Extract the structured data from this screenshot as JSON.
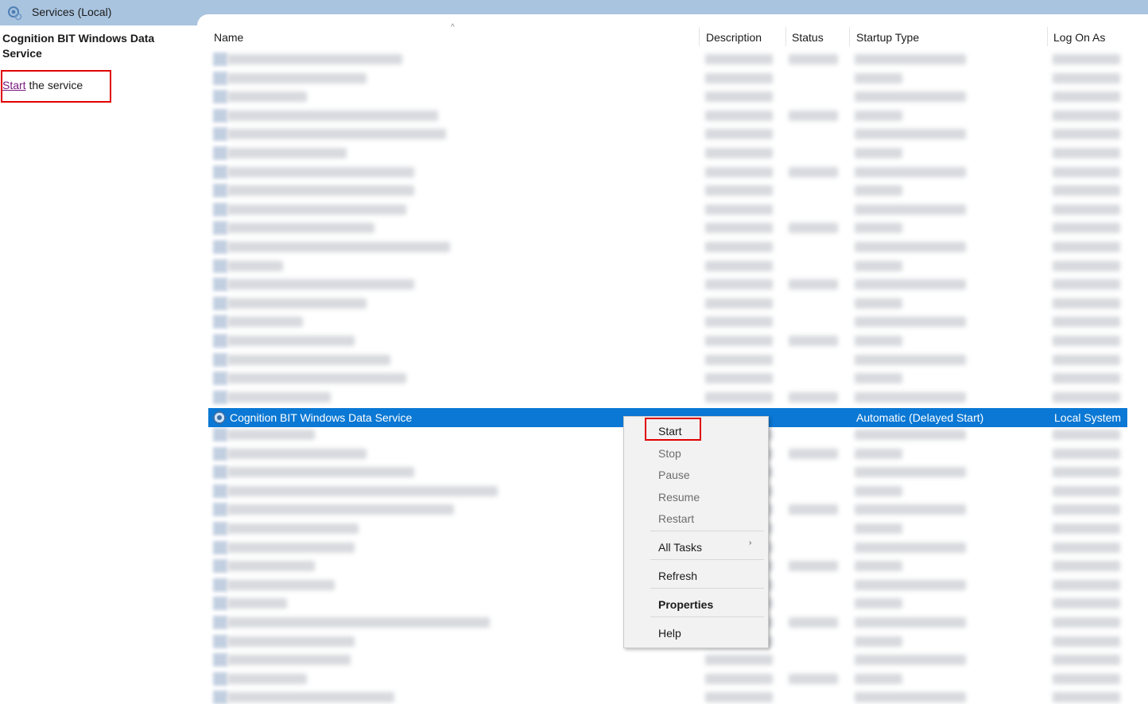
{
  "window": {
    "title": "Services (Local)"
  },
  "left_pane": {
    "service_name": "Cognition BIT Windows Data Service",
    "start_link": "Start",
    "start_suffix": " the service"
  },
  "columns": {
    "name": "Name",
    "description": "Description",
    "status": "Status",
    "startup_type": "Startup Type",
    "log_on_as": "Log On As"
  },
  "selected_row": {
    "name": "Cognition BIT Windows Data Service",
    "startup_type": "Automatic (Delayed Start)",
    "log_on_as": "Local System"
  },
  "context_menu": {
    "start": "Start",
    "stop": "Stop",
    "pause": "Pause",
    "resume": "Resume",
    "restart": "Restart",
    "all_tasks": "All Tasks",
    "refresh": "Refresh",
    "properties": "Properties",
    "help": "Help"
  },
  "colors": {
    "selection": "#0a78d4",
    "highlight_box": "#e00000",
    "title_strip": "#a9c4df"
  }
}
